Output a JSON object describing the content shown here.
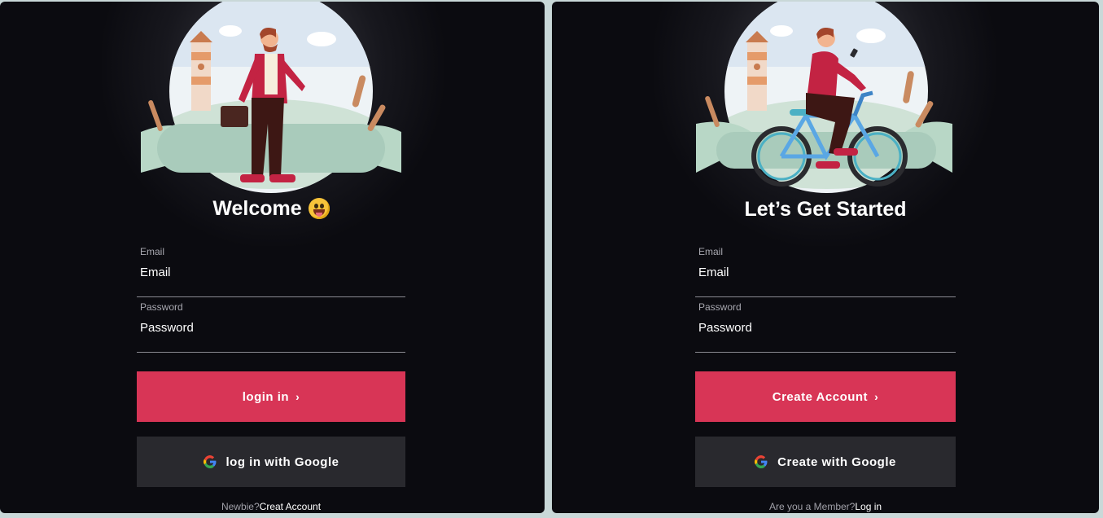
{
  "login": {
    "title": "Welcome",
    "email_label": "Email",
    "email_placeholder": "Email",
    "password_label": "Password",
    "password_placeholder": "Password",
    "primary_button": "login in",
    "google_button": "log in with Google",
    "footer_prompt": "Newbie?",
    "footer_link": "Creat Account"
  },
  "signup": {
    "title": "Let’s Get Started",
    "email_label": "Email",
    "email_placeholder": "Email",
    "password_label": "Password",
    "password_placeholder": "Password",
    "primary_button": "Create Account",
    "google_button": "Create with Google",
    "footer_prompt": "Are you a Member?",
    "footer_link": "Log in"
  },
  "colors": {
    "panel_bg": "#0b0b10",
    "primary": "#d83556",
    "google_bg": "#29292e"
  },
  "icons": [
    "grinning-emoji-icon",
    "chevron-right-icon",
    "google-icon"
  ]
}
